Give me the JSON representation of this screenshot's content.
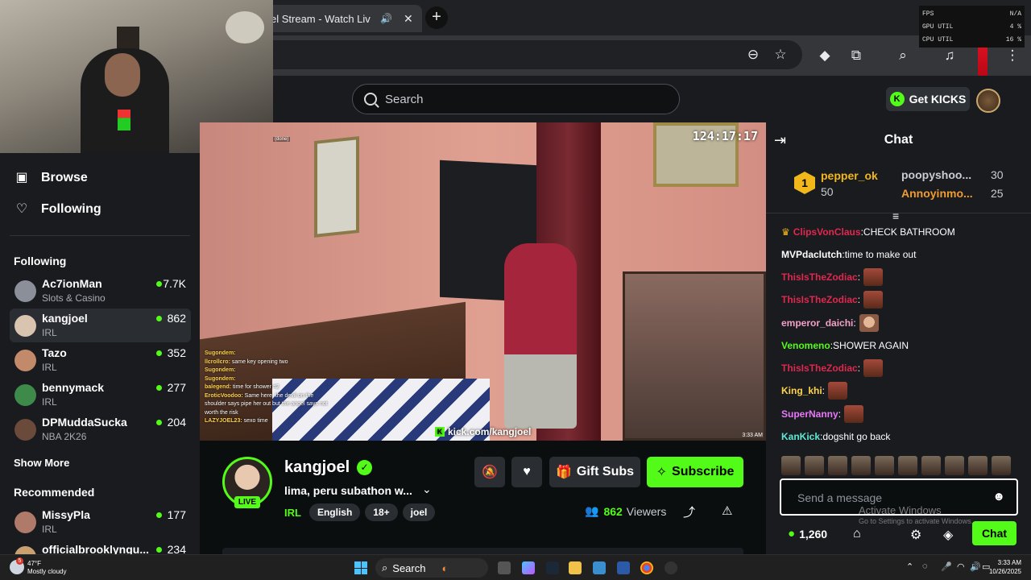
{
  "browser": {
    "tab_title": "el Stream - Watch Liv",
    "tab_audio_icon": "speaker-icon",
    "new_tab_label": "+"
  },
  "overlay": {
    "rows": [
      {
        "label": "FPS",
        "value": "N/A"
      },
      {
        "label": "GPU UTIL",
        "value": "4 %"
      },
      {
        "label": "CPU UTIL",
        "value": "16 %"
      }
    ]
  },
  "header": {
    "search_placeholder": "Search",
    "get_kicks_label": "Get KICKS",
    "get_kicks_badge": "K"
  },
  "sidebar": {
    "nav": [
      {
        "label": "Browse",
        "icon": "browse-icon"
      },
      {
        "label": "Following",
        "icon": "heart-icon"
      }
    ],
    "following_heading": "Following",
    "following": [
      {
        "name": "Ac7ionMan",
        "category": "Slots & Casino",
        "viewers": "7.7K",
        "color": "#8a8f99"
      },
      {
        "name": "kangjoel",
        "category": "IRL",
        "viewers": "862",
        "color": "#d9c4b0",
        "active": true
      },
      {
        "name": "Tazo",
        "category": "IRL",
        "viewers": "352",
        "color": "#c28a6a"
      },
      {
        "name": "bennymack",
        "category": "IRL",
        "viewers": "277",
        "color": "#3d8a4a"
      },
      {
        "name": "DPMuddaSucka",
        "category": "NBA 2K26",
        "viewers": "204",
        "color": "#6a4a3a"
      }
    ],
    "show_more": "Show More",
    "recommended_heading": "Recommended",
    "recommended": [
      {
        "name": "MissyPla",
        "category": "IRL",
        "viewers": "177",
        "color": "#b07a6a"
      },
      {
        "name": "officialbrooklyngu...",
        "category": "",
        "viewers": "234",
        "color": "#c9a070"
      }
    ]
  },
  "video": {
    "timer": "124:17:17",
    "overlay_url": "kick.com/kangjoel",
    "overlay_clock": "3:33 AM",
    "overlay_done": "(done)",
    "chat_overlay": [
      {
        "user": "Sugondem:",
        "text": ""
      },
      {
        "user": "llcrollcro:",
        "text": "same key opening two"
      },
      {
        "user": "Sugondem:",
        "text": ""
      },
      {
        "user": "Sugondem:",
        "text": ""
      },
      {
        "user": "balegend:",
        "text": "time for shower #2"
      },
      {
        "user": "EroticVoodoo:",
        "text": "Same here. the devil on the shoulder says pipe her out but the angel says not worth the risk"
      },
      {
        "user": "LAZYJOEL23:",
        "text": "sexo time"
      }
    ]
  },
  "stream": {
    "name": "kangjoel",
    "live_badge": "LIVE",
    "title": "lima, peru subathon w...",
    "category": "IRL",
    "tags": [
      "English",
      "18+",
      "joel"
    ],
    "gift_subs_label": "Gift Subs",
    "subscribe_label": "Subscribe",
    "viewers_count": "862",
    "viewers_label": "Viewers"
  },
  "chat": {
    "title": "Chat",
    "leaderboard": {
      "first": {
        "rank": "1",
        "name": "pepper_ok",
        "value": "50"
      },
      "second": {
        "name": "poopyshoo...",
        "value": "30"
      },
      "third": {
        "name": "Annoyinmo...",
        "value": "25"
      }
    },
    "messages": [
      {
        "user": "ClipsVonClaus",
        "color": "#e0284f",
        "text": "CHECK BATHROOM",
        "badge": "crown-icon"
      },
      {
        "user": "MVPdaclutch",
        "color": "#ffffff",
        "text": "time to make out"
      },
      {
        "user": "ThisIsTheZodiac",
        "color": "#e0284f",
        "text": ""
      },
      {
        "user": "ThisIsTheZodiac",
        "color": "#e0284f",
        "text": ""
      },
      {
        "user": "emperor_daichi",
        "color": "#f3a0c8",
        "text": ""
      },
      {
        "user": "Venomeno",
        "color": "#53fc18",
        "text": "SHOWER AGAIN"
      },
      {
        "user": "ThisIsTheZodiac",
        "color": "#e0284f",
        "text": ""
      },
      {
        "user": "King_khi",
        "color": "#ffd34a",
        "text": ""
      },
      {
        "user": "SuperNanny",
        "color": "#e879f9",
        "text": ""
      },
      {
        "user": "KanKick",
        "color": "#5eead4",
        "text": "dogshit go back"
      }
    ],
    "input_placeholder": "Send a message",
    "kicks_balance": "1,260",
    "send_label": "Chat"
  },
  "windows": {
    "watermark": "Activate Windows",
    "watermark_sub": "Go to Settings to activate Windows.",
    "weather_temp": "47°F",
    "weather_desc": "Mostly cloudy",
    "weather_badge": "5",
    "taskbar_search": "Search",
    "time": "3:33 AM",
    "date": "10/26/2025"
  }
}
